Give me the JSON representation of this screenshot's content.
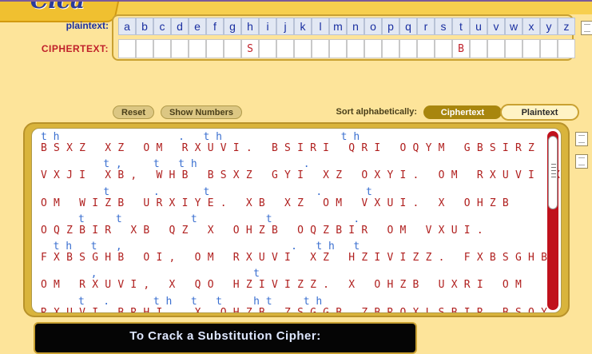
{
  "key": {
    "plaintext_label": "plaintext:",
    "ciphertext_label": "CIPHERTEXT:",
    "letters": [
      "a",
      "b",
      "c",
      "d",
      "e",
      "f",
      "g",
      "h",
      "i",
      "j",
      "k",
      "l",
      "m",
      "n",
      "o",
      "p",
      "q",
      "r",
      "s",
      "t",
      "u",
      "v",
      "w",
      "x",
      "y",
      "z"
    ],
    "cipher": [
      "",
      "",
      "",
      "",
      "",
      "",
      "",
      "S",
      "",
      "",
      "",
      "",
      "",
      "",
      "",
      "",
      "",
      "",
      "",
      "B",
      "",
      "",
      "",
      "",
      "",
      ""
    ]
  },
  "buttons": {
    "reset": "Reset",
    "show_numbers": "Show Numbers"
  },
  "sort": {
    "label": "Sort alphabetically:",
    "ciphertext": "Ciphertext",
    "plaintext": "Plaintext"
  },
  "puzzle_lines": [
    {
      "plain": "t h                   .   t h                   t h",
      "cipher": "B S X Z   X Z   O M   R X U V I .   B S I R I   Q R I   O Q Y M   G B S I R Z"
    },
    {
      "plain": "          t ,     t   t h                 .",
      "cipher": "V X J I   X B ,   W H B   B S X Z   G Y I   X Z   O X Y I .   O M   R X U V I   X Z"
    },
    {
      "plain": "          t       .       t                 .       t",
      "cipher": "O M   W I Z B   U R X I Y E .   X B   X Z   O M   V X U I .   X   O H Z B"
    },
    {
      "plain": "      t     t           t           t             .",
      "cipher": "O Q Z B I R   X B   Q Z   X   O H Z B   O Q Z B I R   O M   V X U I ."
    },
    {
      "plain": "  t h   t   ,                           .   t h   t",
      "cipher": "F X B S G H B   O I ,   O M   R X U V I   X Z   H Z I V I Z Z .   F X B S G H B"
    },
    {
      "plain": "        ,                         t",
      "cipher": "O M   R X U V I ,   X   Q O   H Z I V I Z Z .   X   O H Z B   U X R I   O M"
    },
    {
      "plain": "      t   .       t h   t   t     h t     t h",
      "cipher": "R X U V I   B R H I .   X   O H Z B   Z S G G B   Z B R Q X L S B I R   B S Q Y"
    }
  ],
  "banner": {
    "title": "To Crack a Substitution Cipher:"
  },
  "logo": {
    "text": "Cica"
  }
}
